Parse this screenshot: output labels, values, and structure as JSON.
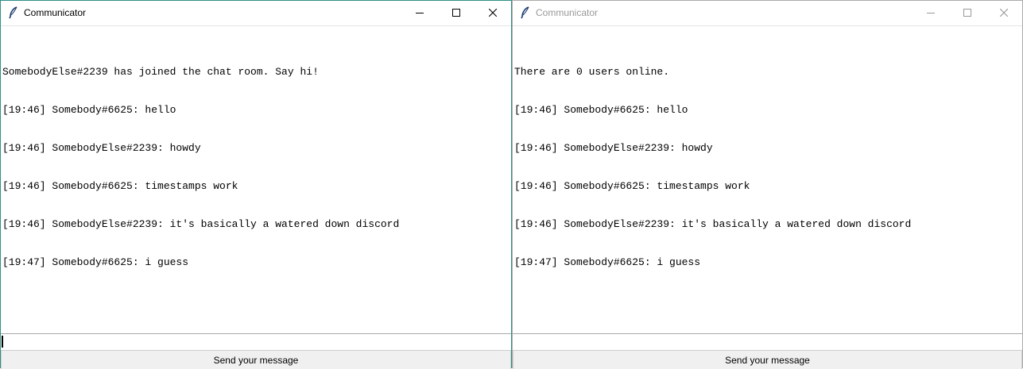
{
  "windows": [
    {
      "title": "Communicator",
      "active": true,
      "chat_lines": [
        "SomebodyElse#2239 has joined the chat room. Say hi!",
        "[19:46] Somebody#6625: hello",
        "[19:46] SomebodyElse#2239: howdy",
        "[19:46] Somebody#6625: timestamps work",
        "[19:46] SomebodyElse#2239: it's basically a watered down discord",
        "[19:47] Somebody#6625: i guess"
      ],
      "input_value": "",
      "send_label": "Send your message"
    },
    {
      "title": "Communicator",
      "active": false,
      "chat_lines": [
        "There are 0 users online.",
        "[19:46] Somebody#6625: hello",
        "[19:46] SomebodyElse#2239: howdy",
        "[19:46] Somebody#6625: timestamps work",
        "[19:46] SomebodyElse#2239: it's basically a watered down discord",
        "[19:47] Somebody#6625: i guess"
      ],
      "input_value": "",
      "send_label": "Send your message"
    }
  ],
  "icons": {
    "app": "feather-icon",
    "minimize": "minimize-icon",
    "maximize": "maximize-icon",
    "close": "close-icon"
  },
  "colors": {
    "active_border": "#2f8f86",
    "inactive_title": "#999999",
    "button_bg": "#f0f0f0"
  }
}
